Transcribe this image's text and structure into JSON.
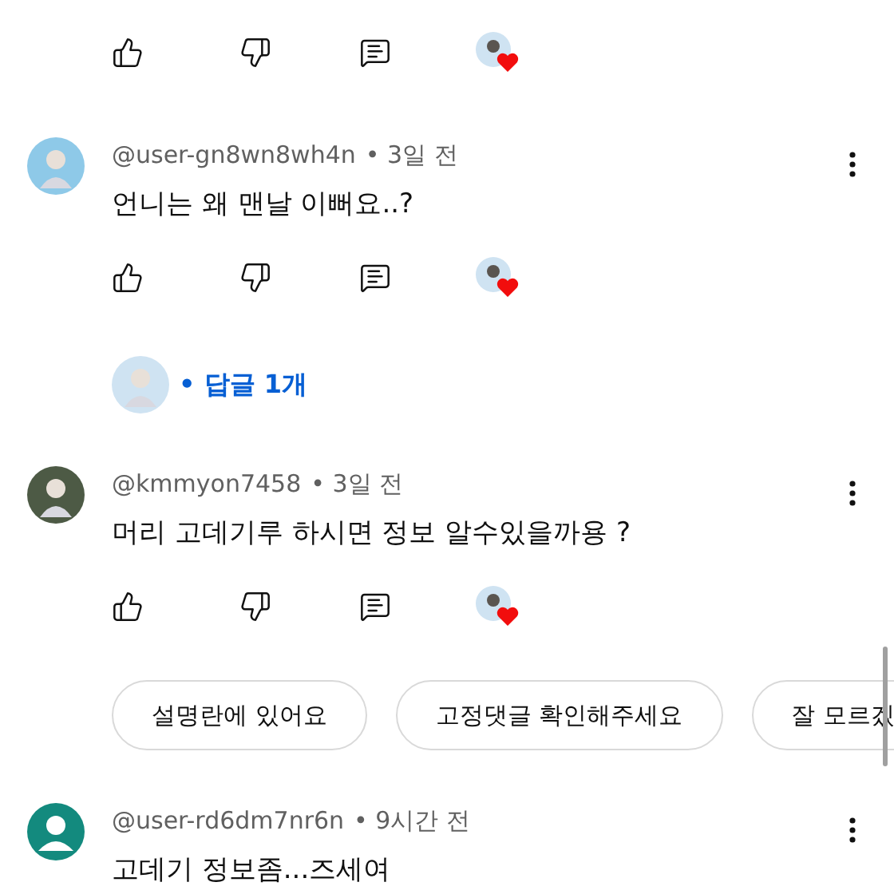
{
  "items": [
    {
      "kind": "actions",
      "hearted": true
    },
    {
      "kind": "comment",
      "avatar": {
        "kind": "photo",
        "color": "#8ec9e8"
      },
      "author": "@user-gn8wn8wh4n",
      "age": "• 3일 전",
      "text": "언니는 왜 맨날 이뻐요..?",
      "hearted": true,
      "replies": "• 답글 1개"
    },
    {
      "kind": "comment",
      "avatar": {
        "kind": "photo",
        "color": "#4d5a45"
      },
      "author": "@kmmyon7458",
      "age": "• 3일 전",
      "text": "머리 고데기루 하시면 정보 알수있을까용 ?",
      "hearted": true
    },
    {
      "kind": "chips",
      "chips": [
        "설명란에 있어요",
        "고정댓글 확인해주세요",
        "잘 모르겠"
      ]
    },
    {
      "kind": "comment",
      "avatar": {
        "kind": "default",
        "color": "#138a7e"
      },
      "author": "@user-rd6dm7nr6n",
      "age": "• 9시간 전",
      "text": "고데기 정보좀...즈세여"
    }
  ]
}
